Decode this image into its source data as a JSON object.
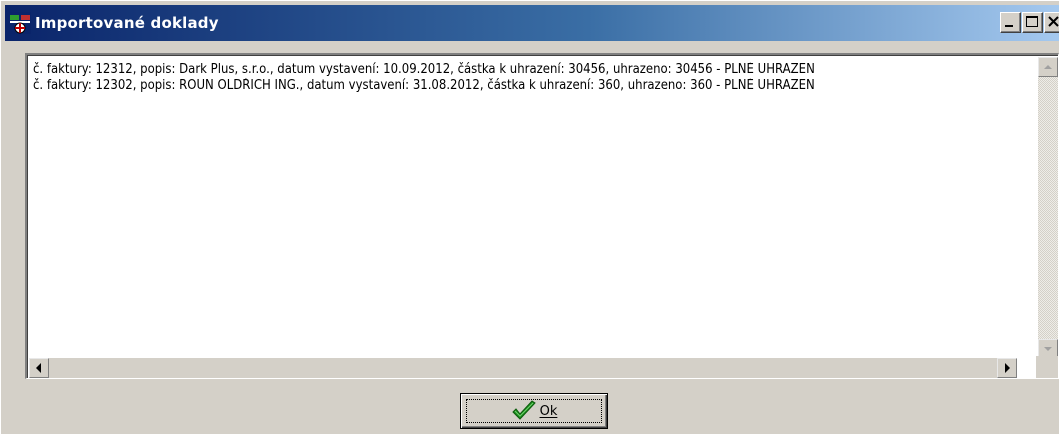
{
  "window": {
    "title": "Importované doklady"
  },
  "titlebar": {
    "icon": "app-icon",
    "gradient_start": "#0a246a",
    "gradient_end": "#a6caf0",
    "buttons": [
      "minimize-icon",
      "maximize-icon",
      "close-icon"
    ]
  },
  "list": {
    "items": [
      "č. faktury: 12312, popis: Dark Plus, s.r.o., datum vystavení: 10.09.2012, částka k uhrazení: 30456, uhrazeno: 30456 - PLNĚ UHRAZEN",
      "č. faktury: 12302, popis: ROUN OLDŘICH ING., datum vystavení: 31.08.2012, částka k uhrazení: 360, uhrazeno: 360 - PLNĚ UHRAZEN"
    ]
  },
  "buttons": {
    "ok_label": "Ok",
    "ok_icon": "checkmark-icon",
    "ok_icon_color": "#1a8a1a"
  }
}
